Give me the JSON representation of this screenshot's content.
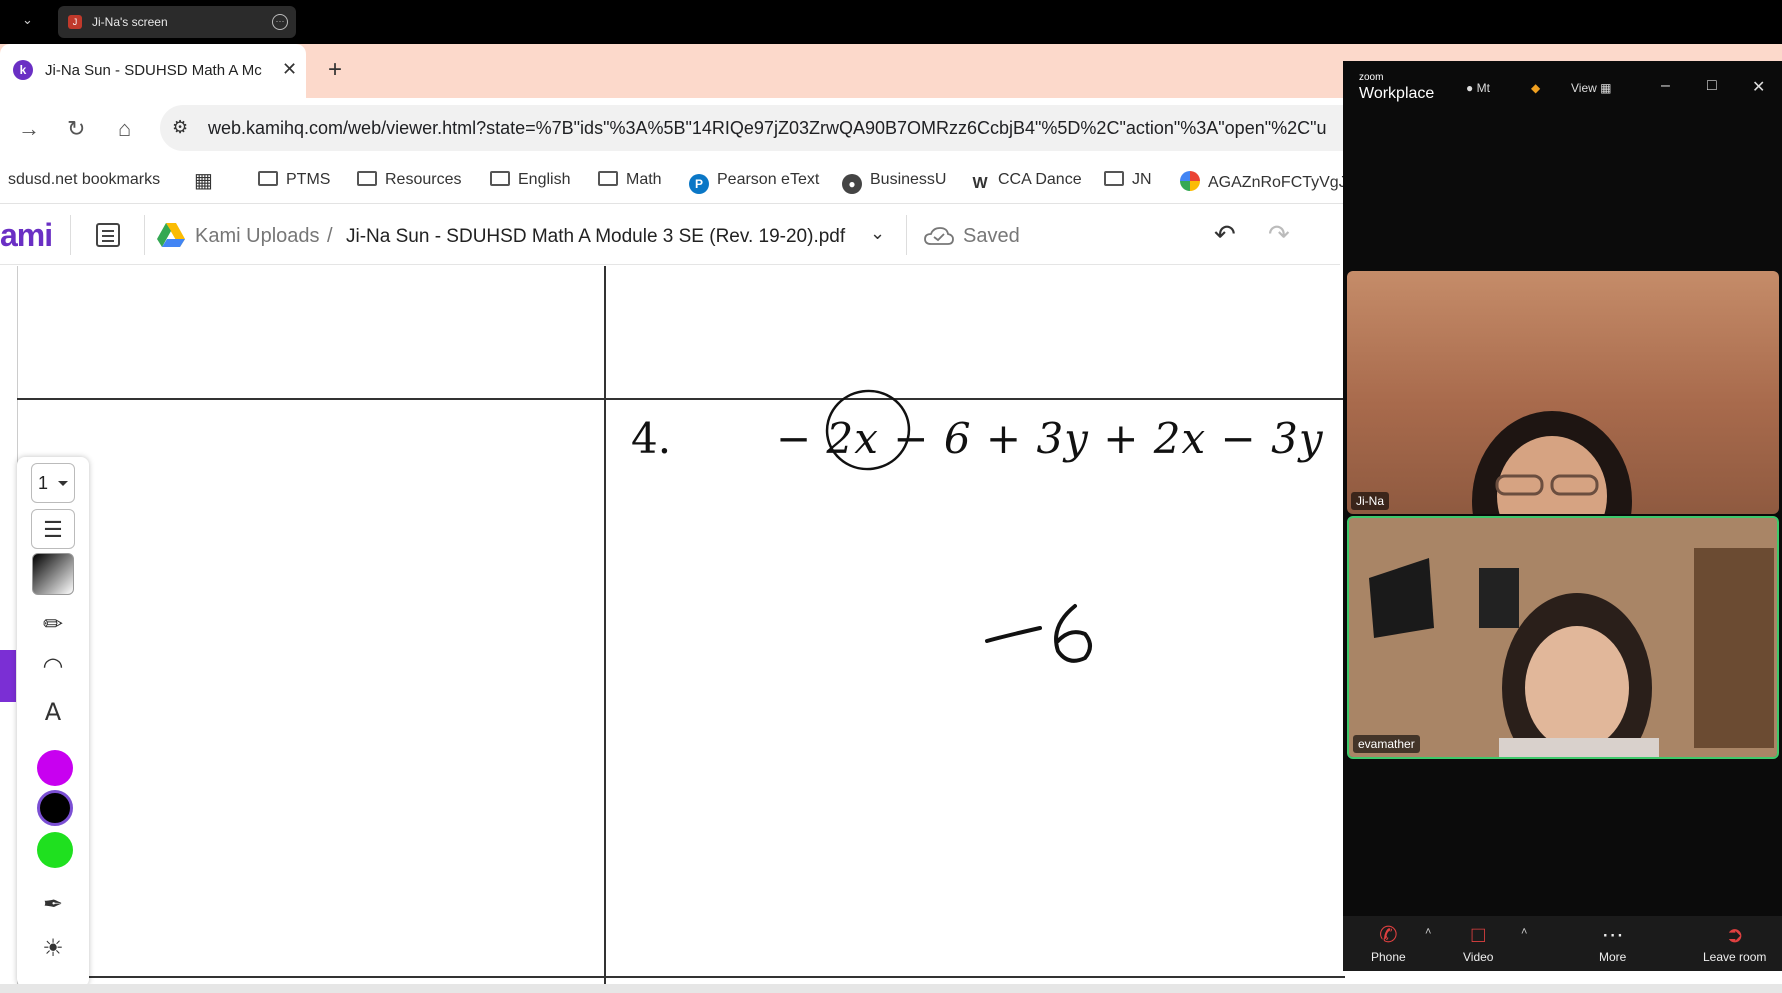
{
  "share_bar": {
    "title": "Ji-Na's screen",
    "avatar_letter": "J"
  },
  "browser": {
    "tab_title": "Ji-Na Sun - SDUHSD Math A Mc",
    "tab_favicon": "k",
    "url": "web.kamihq.com/web/viewer.html?state=%7B\"ids\"%3A%5B\"14RIQe97jZ03ZrwQA90B7OMRzz6CcbjB4\"%5D%2C\"action\"%3A\"open\"%2C\"u",
    "bookmarks": [
      {
        "label": "sdusd.net bookmarks",
        "icon": "none"
      },
      {
        "label": "PTMS",
        "icon": "folder-icon"
      },
      {
        "label": "Resources",
        "icon": "folder-icon"
      },
      {
        "label": "English",
        "icon": "folder-icon"
      },
      {
        "label": "Math",
        "icon": "folder-icon"
      },
      {
        "label": "Pearson eText",
        "icon": "pearson-icon"
      },
      {
        "label": "BusinessU",
        "icon": "globe-icon"
      },
      {
        "label": "CCA Dance",
        "icon": "w-icon"
      },
      {
        "label": "JN",
        "icon": "folder-icon"
      },
      {
        "label": "AGAZnRoFCTyVgJ",
        "icon": "pinwheel-icon"
      }
    ]
  },
  "kami": {
    "logo": "ami",
    "breadcrumb_root": "Kami Uploads",
    "breadcrumb_sep": "/",
    "file_name": "Ji-Na Sun - SDUHSD Math A Module 3 SE (Rev. 19-20).pdf",
    "save_status": "Saved",
    "page_selector": "1"
  },
  "document": {
    "problem_number": "4.",
    "expression": "− 2x − 6 + 3y + 2x − 3y",
    "handwritten_answer": "−6"
  },
  "tools": {
    "colors": [
      "#c800f0",
      "#000000",
      "#1fe01f"
    ],
    "selected_color": "#000000"
  },
  "zoom": {
    "brand_small": "zoom",
    "brand": "Workplace",
    "meeting_label": "Mt",
    "view_label": "View",
    "participants": [
      {
        "name": "Ji-Na"
      },
      {
        "name": "evamather"
      }
    ],
    "footer": {
      "phone": "Phone",
      "video": "Video",
      "more": "More",
      "leave": "Leave room"
    }
  }
}
